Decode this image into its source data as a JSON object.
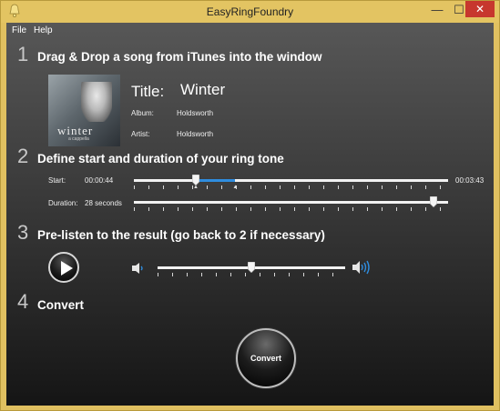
{
  "window": {
    "title": "EasyRingFoundry",
    "minimize_glyph": "—",
    "maximize_glyph": "☐",
    "close_glyph": "✕"
  },
  "menu": {
    "file": "File",
    "help": "Help"
  },
  "steps": [
    {
      "number": "1",
      "title": "Drag & Drop a song from iTunes into the window"
    },
    {
      "number": "2",
      "title": "Define start and duration of your ring tone"
    },
    {
      "number": "3",
      "title": "Pre-listen to the result (go back to 2 if necessary)"
    },
    {
      "number": "4",
      "title": "Convert"
    }
  ],
  "song": {
    "title_label": "Title:",
    "title_value": "Winter",
    "album_label": "Album:",
    "album_value": "Holdsworth",
    "artist_label": "Artist:",
    "artist_value": "Holdsworth",
    "art_title": "winter",
    "art_sub": "a cappella"
  },
  "timing": {
    "start_label": "Start:",
    "start_value": "00:00:44",
    "end_value": "00:03:43",
    "duration_label": "Duration:",
    "duration_value": "28 seconds",
    "start_fraction": 0.197,
    "selection_end_fraction": 0.323,
    "duration_fraction": 0.955
  },
  "playback": {
    "volume_fraction": 0.5
  },
  "convert": {
    "label": "Convert"
  },
  "icons": {
    "app": "bell-icon",
    "play": "play-icon",
    "volume_low": "speaker-low-icon",
    "volume_high": "speaker-high-icon"
  },
  "colors": {
    "accent": "#2f8ddf",
    "titlebar": "#e3c462",
    "close": "#c7372e"
  }
}
